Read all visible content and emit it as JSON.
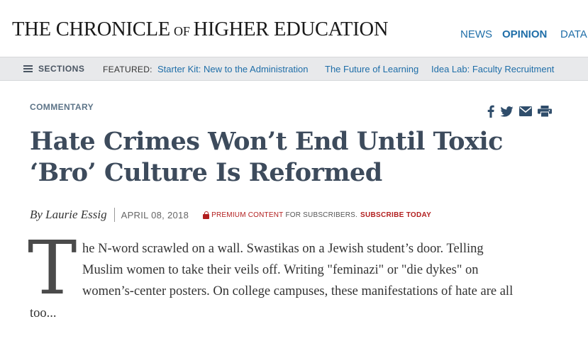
{
  "header": {
    "brand_main_1": "THE CHRONICLE",
    "brand_of": "OF",
    "brand_main_2": "HIGHER EDUCATION",
    "nav": {
      "news": "NEWS",
      "opinion": "OPINION",
      "data": "DATA"
    }
  },
  "sections_bar": {
    "sections_label": "SECTIONS",
    "featured_label": "FEATURED:",
    "featured_links": [
      "Starter Kit: New to the Administration",
      "The Future of Learning",
      "Idea Lab: Faculty Recruitment"
    ]
  },
  "article": {
    "kicker": "COMMENTARY",
    "headline": "Hate Crimes Won’t End Until Toxic ‘Bro’ Culture Is Reformed",
    "byline": "By Laurie Essig",
    "date": "APRIL 08, 2018",
    "premium_label": "PREMIUM CONTENT",
    "premium_note": "FOR SUBSCRIBERS.",
    "subscribe_label": "SUBSCRIBE TODAY",
    "dropcap": "T",
    "body_lines": [
      "he N-word scrawled on a wall. Swastikas on a Jewish student’s door. Telling",
      "Muslim women to take their veils off. Writing \"feminazi\" or \"die dykes\" on",
      "women’s-center posters. On college campuses, these manifestations of hate are all",
      "too..."
    ]
  },
  "share_icons": [
    "facebook-icon",
    "twitter-icon",
    "email-icon",
    "print-icon"
  ],
  "colors": {
    "link_blue": "#1f6ea8",
    "headline": "#3d4b5c",
    "premium_red": "#b21e1e",
    "bar_bg": "#e8e9eb"
  }
}
